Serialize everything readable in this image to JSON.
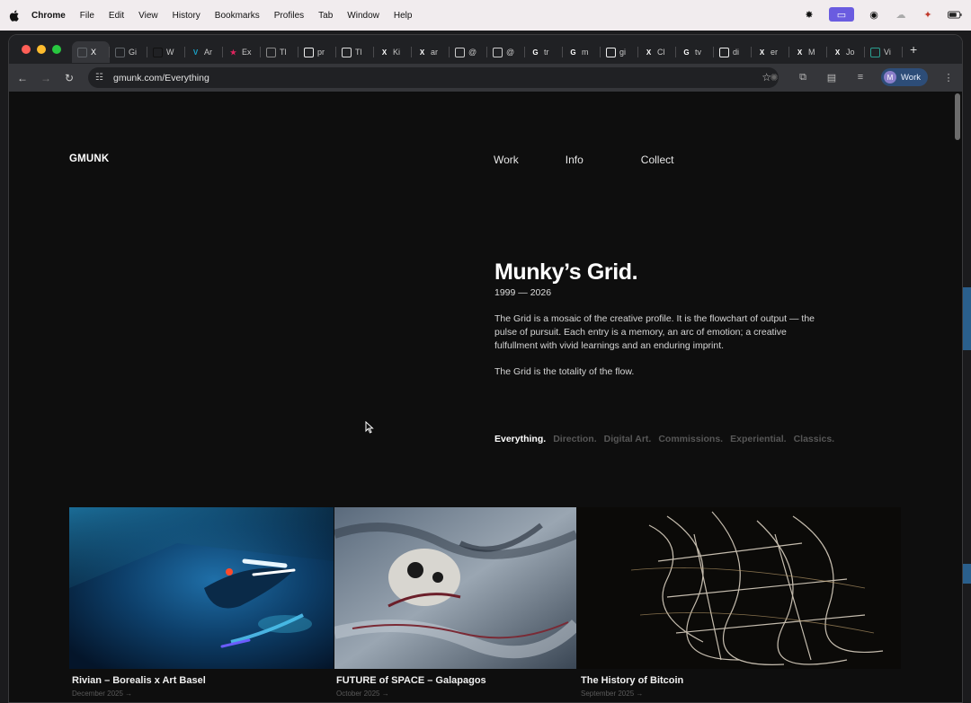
{
  "menubar": {
    "items": [
      "Chrome",
      "File",
      "Edit",
      "View",
      "History",
      "Bookmarks",
      "Profiles",
      "Tab",
      "Window",
      "Help"
    ]
  },
  "tabs": [
    {
      "label": "X",
      "fav": "",
      "color": "#5f6368",
      "active": true
    },
    {
      "label": "Gi",
      "fav": "",
      "color": "#5f6368"
    },
    {
      "label": "W",
      "fav": "",
      "color": "#111111"
    },
    {
      "label": "Ar",
      "fav": "V",
      "color": "#1aa3c9"
    },
    {
      "label": "Ex",
      "fav": "★",
      "color": "#e0245e"
    },
    {
      "label": "Tl",
      "fav": "",
      "color": "#888888"
    },
    {
      "label": "pr",
      "fav": "",
      "color": "#eeeeee"
    },
    {
      "label": "Tl",
      "fav": "",
      "color": "#dddddd"
    },
    {
      "label": "Ki",
      "fav": "X",
      "color": "#ffffff"
    },
    {
      "label": "ar",
      "fav": "X",
      "color": "#ffffff"
    },
    {
      "label": "@",
      "fav": "",
      "color": "#cccccc"
    },
    {
      "label": "@",
      "fav": "",
      "color": "#cccccc"
    },
    {
      "label": "tr",
      "fav": "G",
      "color": "#ffffff"
    },
    {
      "label": "m",
      "fav": "G",
      "color": "#ffffff"
    },
    {
      "label": "gi",
      "fav": "",
      "color": "#eeeeee"
    },
    {
      "label": "Cl",
      "fav": "X",
      "color": "#ffffff"
    },
    {
      "label": "tv",
      "fav": "G",
      "color": "#ffffff"
    },
    {
      "label": "di",
      "fav": "",
      "color": "#eeeeee"
    },
    {
      "label": "er",
      "fav": "X",
      "color": "#ffffff"
    },
    {
      "label": "M",
      "fav": "X",
      "color": "#ffffff"
    },
    {
      "label": "Jo",
      "fav": "X",
      "color": "#ffffff"
    },
    {
      "label": "Vi",
      "fav": "",
      "color": "#2a9d8f"
    }
  ],
  "toolbar": {
    "url": "gmunk.com/Everything",
    "profile_initial": "M",
    "profile_label": "Work"
  },
  "site": {
    "logo": "GMUNK",
    "nav": [
      "Work",
      "Info",
      "Collect"
    ],
    "title": "Munky’s Grid.",
    "years": "1999 — 2026",
    "description": "The Grid is a mosaic of the creative profile. It is the flowchart of output — the pulse of pursuit. Each entry is a memory, an arc of emotion; a creative fulfullment with vivid learnings and an enduring imprint.",
    "description2": "The Grid is the totality of the flow.",
    "filters": [
      "Everything.",
      "Direction.",
      "Digital Art.",
      "Commissions.",
      "Experiential.",
      "Classics."
    ],
    "grid": [
      {
        "title": "Rivian – Borealis x Art Basel",
        "date": "December 2025 →"
      },
      {
        "title": "FUTURE of SPACE – Galapagos",
        "date": "October 2025 →"
      },
      {
        "title": "The History of Bitcoin",
        "date": "September 2025 →"
      }
    ]
  },
  "colors": {
    "page_bg": "#0e0e0e",
    "accent_profile": "#2d4d78",
    "filter_inactive": "#575757"
  }
}
